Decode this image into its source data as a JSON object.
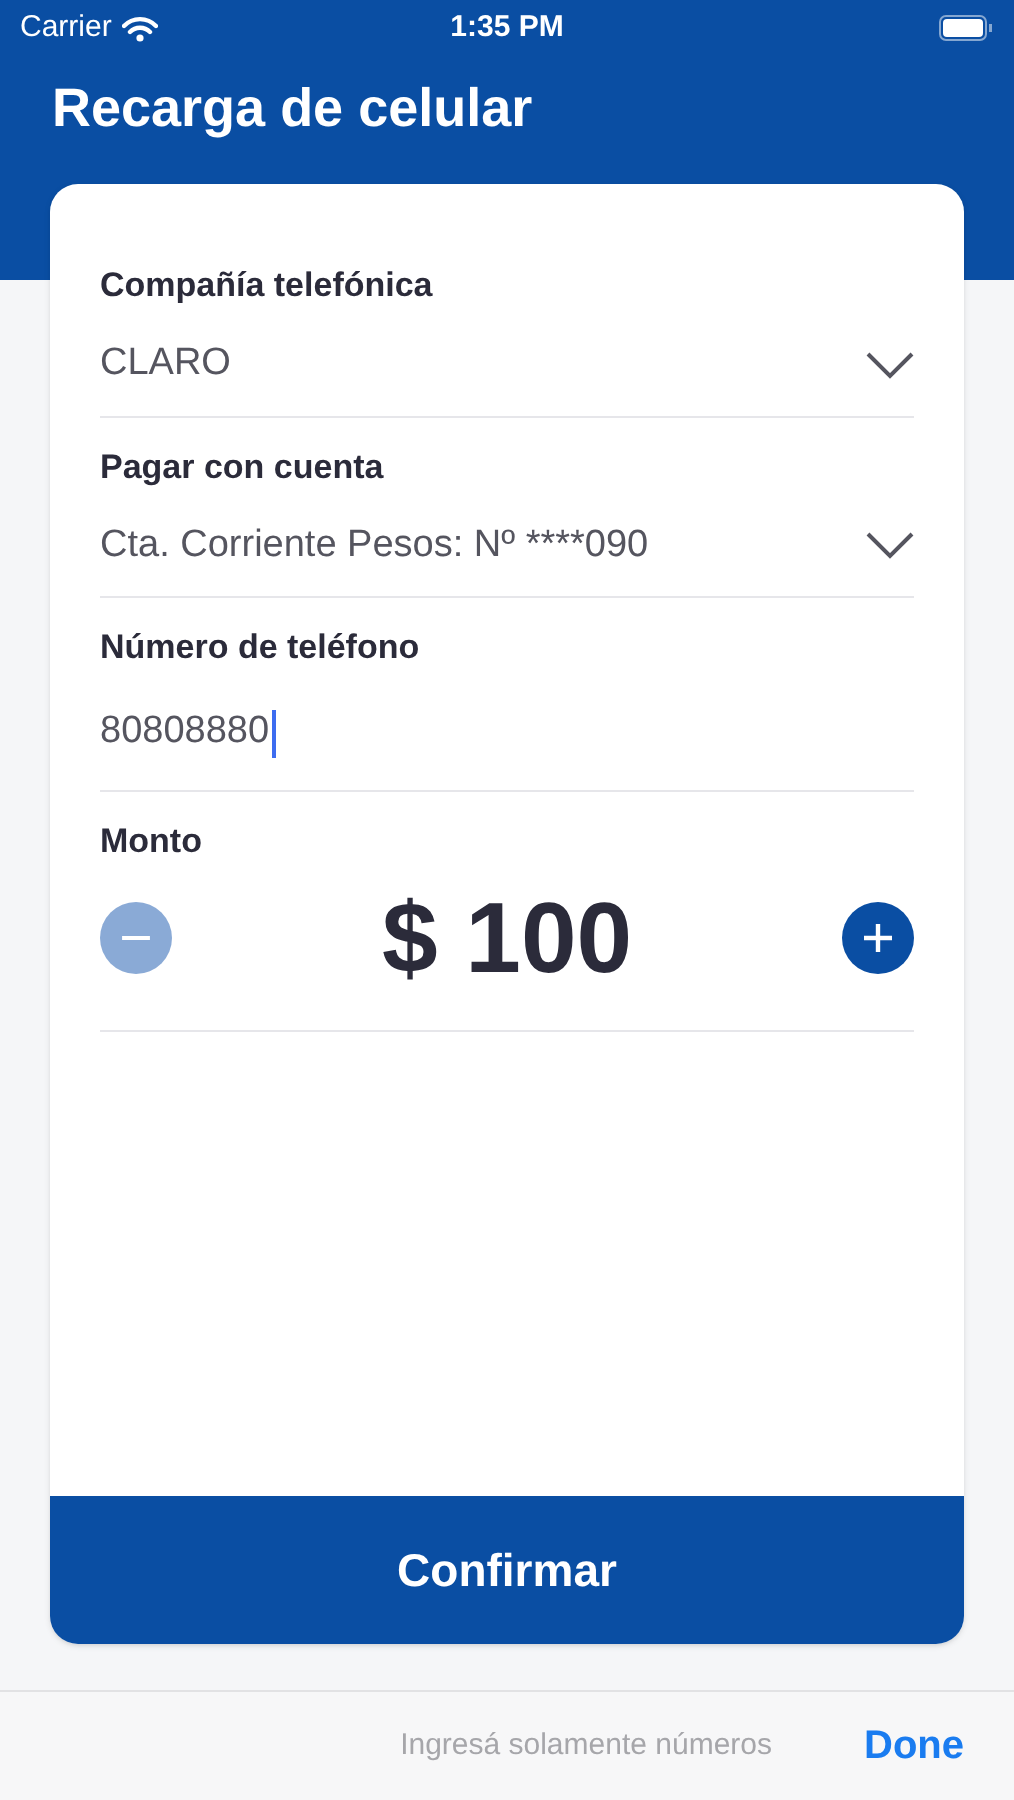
{
  "status_bar": {
    "carrier": "Carrier",
    "time": "1:35 PM"
  },
  "title": "Recarga de celular",
  "fields": [
    {
      "kind": "select",
      "label": "Compañía telefónica",
      "value": "CLARO"
    },
    {
      "kind": "select",
      "label": "Pagar con cuenta",
      "value": "Cta. Corriente Pesos: Nº ****090"
    },
    {
      "kind": "input",
      "label": "Número de teléfono",
      "value": "80808880",
      "focused": true
    }
  ],
  "amount": {
    "label": "Monto",
    "value": "$ 100",
    "decrement_disabled": true,
    "increment_disabled": false
  },
  "confirm_button": "Confirmar",
  "keyboard_toolbar": {
    "hint": "Ingresá solamente números",
    "done": "Done"
  }
}
